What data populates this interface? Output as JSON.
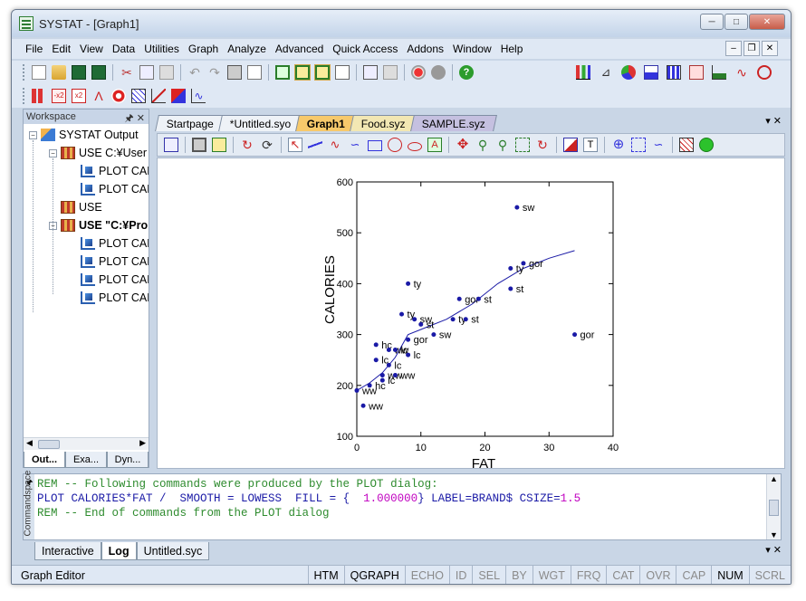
{
  "window": {
    "title": "SYSTAT - [Graph1]"
  },
  "menu": [
    "File",
    "Edit",
    "View",
    "Data",
    "Utilities",
    "Graph",
    "Analyze",
    "Advanced",
    "Quick Access",
    "Addons",
    "Window",
    "Help"
  ],
  "workspace": {
    "header": "Workspace",
    "tree": [
      {
        "label": "SYSTAT Output",
        "level": 0,
        "icon": "output",
        "expander": "−"
      },
      {
        "label": "USE C:¥User",
        "level": 1,
        "icon": "table",
        "expander": "−"
      },
      {
        "label": "PLOT CAL",
        "level": 2,
        "icon": "plot"
      },
      {
        "label": "PLOT CAL",
        "level": 2,
        "icon": "plot"
      },
      {
        "label": "USE",
        "level": 1,
        "icon": "table"
      },
      {
        "label": "USE \"C:¥Pro",
        "level": 1,
        "icon": "table",
        "expander": "−",
        "bold": true
      },
      {
        "label": "PLOT CAL",
        "level": 2,
        "icon": "plot"
      },
      {
        "label": "PLOT CAL",
        "level": 2,
        "icon": "plot"
      },
      {
        "label": "PLOT CAL",
        "level": 2,
        "icon": "plot"
      },
      {
        "label": "PLOT CAL",
        "level": 2,
        "icon": "plot"
      }
    ],
    "tabs": [
      "Out...",
      "Exa...",
      "Dyn..."
    ]
  },
  "doc_tabs": [
    "Startpage",
    "*Untitled.syo",
    "Graph1",
    "Food.syz",
    "SAMPLE.syz"
  ],
  "chart_data": {
    "type": "scatter",
    "xlabel": "FAT",
    "ylabel": "CALORIES",
    "xlim": [
      0,
      40
    ],
    "ylim": [
      100,
      600
    ],
    "xticks": [
      0,
      10,
      20,
      30,
      40
    ],
    "yticks": [
      100,
      200,
      300,
      400,
      500,
      600
    ],
    "points": [
      {
        "x": 25,
        "y": 550,
        "label": "sw"
      },
      {
        "x": 26,
        "y": 440,
        "label": "gor"
      },
      {
        "x": 24,
        "y": 430,
        "label": "ty"
      },
      {
        "x": 24,
        "y": 390,
        "label": "st"
      },
      {
        "x": 8,
        "y": 400,
        "label": "ty"
      },
      {
        "x": 16,
        "y": 370,
        "label": "gor"
      },
      {
        "x": 19,
        "y": 370,
        "label": "st"
      },
      {
        "x": 7,
        "y": 340,
        "label": "ty"
      },
      {
        "x": 9,
        "y": 330,
        "label": "sw"
      },
      {
        "x": 10,
        "y": 320,
        "label": "st"
      },
      {
        "x": 15,
        "y": 330,
        "label": "ty"
      },
      {
        "x": 17,
        "y": 330,
        "label": "st"
      },
      {
        "x": 12,
        "y": 300,
        "label": "sw"
      },
      {
        "x": 8,
        "y": 290,
        "label": "gor"
      },
      {
        "x": 34,
        "y": 300,
        "label": "gor"
      },
      {
        "x": 3,
        "y": 280,
        "label": "hc"
      },
      {
        "x": 5,
        "y": 270,
        "label": "ww"
      },
      {
        "x": 6,
        "y": 270,
        "label": "lc"
      },
      {
        "x": 8,
        "y": 260,
        "label": "lc"
      },
      {
        "x": 3,
        "y": 250,
        "label": "lc"
      },
      {
        "x": 5,
        "y": 240,
        "label": "lc"
      },
      {
        "x": 4,
        "y": 220,
        "label": "ww"
      },
      {
        "x": 6,
        "y": 220,
        "label": "ww"
      },
      {
        "x": 4,
        "y": 210,
        "label": "lc"
      },
      {
        "x": 2,
        "y": 200,
        "label": "hc"
      },
      {
        "x": 0,
        "y": 190,
        "label": "ww"
      },
      {
        "x": 1,
        "y": 160,
        "label": "ww"
      }
    ],
    "smooth": [
      [
        0,
        190
      ],
      [
        2,
        205
      ],
      [
        4,
        225
      ],
      [
        6,
        255
      ],
      [
        8,
        300
      ],
      [
        10,
        310
      ],
      [
        14,
        330
      ],
      [
        18,
        360
      ],
      [
        22,
        400
      ],
      [
        26,
        430
      ],
      [
        30,
        450
      ],
      [
        34,
        465
      ]
    ]
  },
  "commands": {
    "side_label": "Commandspace",
    "lines": [
      [
        {
          "t": "REM -- Following commands were produced by the PLOT dialog:",
          "c": "#2e8b2e"
        }
      ],
      [
        {
          "t": "PLOT CALORIES*FAT /  ",
          "c": "#1a1aa6"
        },
        {
          "t": "SMOOTH",
          "c": "#1a1aa6"
        },
        {
          "t": " = LOWESS  FILL = {  ",
          "c": "#1a1aa6"
        },
        {
          "t": "1.000000",
          "c": "#c000c0"
        },
        {
          "t": "} LABEL=BRAND$ CSIZE=",
          "c": "#1a1aa6"
        },
        {
          "t": "1.5",
          "c": "#c000c0"
        }
      ],
      [
        {
          "t": "REM -- End of commands from the PLOT dialog",
          "c": "#2e8b2e"
        }
      ]
    ],
    "tabs": [
      "Interactive",
      "Log",
      "Untitled.syc"
    ]
  },
  "status": {
    "text": "Graph Editor",
    "cells": [
      {
        "label": "HTM",
        "on": true
      },
      {
        "label": "QGRAPH",
        "on": true
      },
      {
        "label": "ECHO",
        "on": false
      },
      {
        "label": "ID",
        "on": false
      },
      {
        "label": "SEL",
        "on": false
      },
      {
        "label": "BY",
        "on": false
      },
      {
        "label": "WGT",
        "on": false
      },
      {
        "label": "FRQ",
        "on": false
      },
      {
        "label": "CAT",
        "on": false
      },
      {
        "label": "OVR",
        "on": false
      },
      {
        "label": "CAP",
        "on": false
      },
      {
        "label": "NUM",
        "on": true
      },
      {
        "label": "SCRL",
        "on": false
      }
    ]
  },
  "colors": {
    "point": "#1a1aa6",
    "accent": "#f7c96b"
  }
}
